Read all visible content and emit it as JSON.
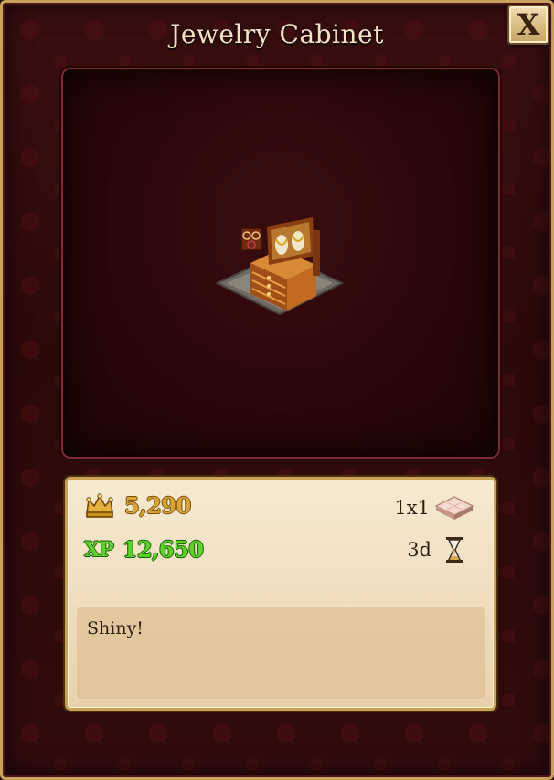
{
  "dialog": {
    "title": "Jewelry Cabinet",
    "close_label": "X"
  },
  "item": {
    "image_name": "jewelry-cabinet-image",
    "cost_coins": "5,290",
    "xp_label": "XP",
    "xp_value": "12,650",
    "size": "1x1",
    "build_time": "3d",
    "description": "Shiny!"
  },
  "colors": {
    "frame_gold": "#c9a15a",
    "coin_gold": "#d8a435",
    "xp_green": "#5bd12a",
    "panel_parchment": "#efdcbc",
    "background_red": "#2c0909"
  },
  "icons": {
    "coins": "crown-icon",
    "size": "footprint-tile-icon",
    "time": "hourglass-icon",
    "close": "close-icon"
  }
}
